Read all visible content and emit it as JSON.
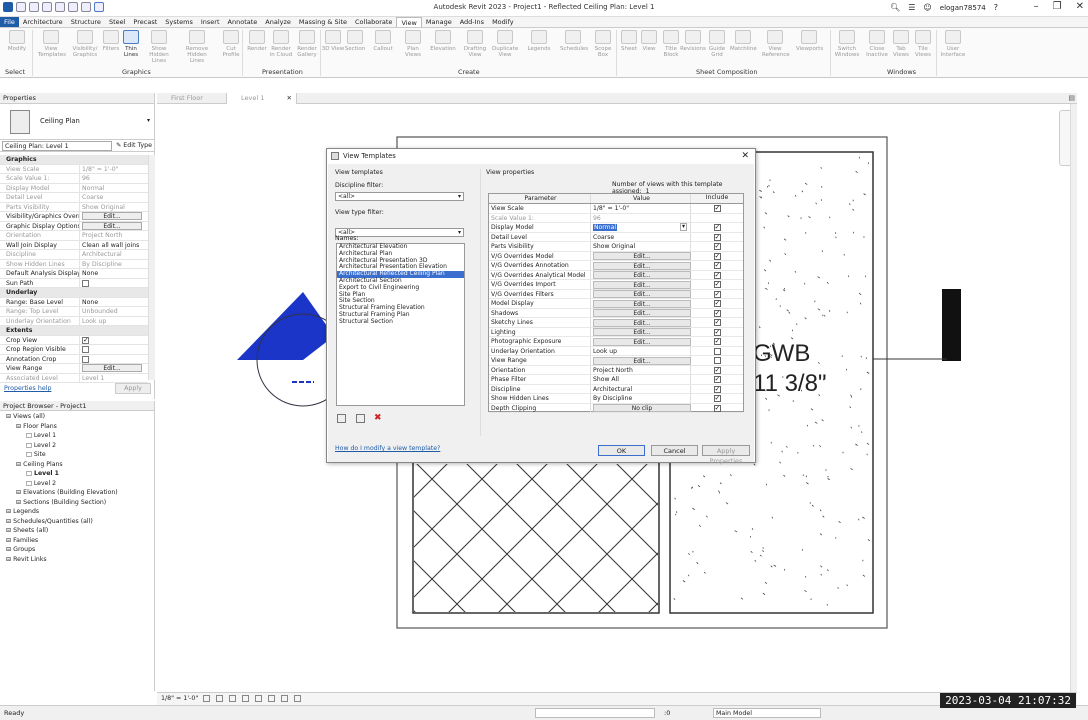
{
  "titlebar": {
    "title": "Autodesk Revit 2023 - Project1 - Reflected Ceiling Plan: Level 1",
    "user": "elogan78574"
  },
  "tabs": [
    "File",
    "Architecture",
    "Structure",
    "Steel",
    "Precast",
    "Systems",
    "Insert",
    "Annotate",
    "Analyze",
    "Massing & Site",
    "Collaborate",
    "View",
    "Manage",
    "Add-Ins",
    "Modify"
  ],
  "ribbon": {
    "buttons": [
      "Modify",
      "View Templates",
      "Visibility/ Graphics",
      "Filters",
      "Thin Lines",
      "Show Hidden Lines",
      "Remove Hidden Lines",
      "Cut Profile",
      "Render",
      "Render in Cloud",
      "Render Gallery",
      "3D View",
      "Section",
      "Callout",
      "Plan Views",
      "Elevation",
      "Drafting View",
      "Duplicate View",
      "Legends",
      "Schedules",
      "Scope Box",
      "Sheet",
      "View",
      "Title Block",
      "Revisions",
      "Guide Grid",
      "Matchline",
      "View Reference",
      "Viewports",
      "Switch Windows",
      "Close Inactive",
      "Tab Views",
      "Tile Views",
      "User Interface"
    ],
    "groups": [
      "Select",
      "Graphics",
      "Presentation",
      "Create",
      "Sheet Composition",
      "Windows"
    ]
  },
  "properties": {
    "title": "Properties",
    "type_name": "Ceiling Plan",
    "instance": "Ceiling Plan: Level 1",
    "edit_type": "Edit Type",
    "rows": [
      {
        "k": "Graphics",
        "sec": true
      },
      {
        "k": "View Scale",
        "v": "1/8\" = 1'-0\"",
        "dim": true
      },
      {
        "k": "Scale Value    1:",
        "v": "96",
        "dim": true
      },
      {
        "k": "Display Model",
        "v": "Normal",
        "dim": true
      },
      {
        "k": "Detail Level",
        "v": "Coarse",
        "dim": true
      },
      {
        "k": "Parts Visibility",
        "v": "Show Original",
        "dim": true
      },
      {
        "k": "Visibility/Graphics Overr...",
        "v": "Edit...",
        "btn": true
      },
      {
        "k": "Graphic Display Options",
        "v": "Edit...",
        "btn": true
      },
      {
        "k": "Orientation",
        "v": "Project North",
        "dim": true
      },
      {
        "k": "Wall Join Display",
        "v": "Clean all wall joins"
      },
      {
        "k": "Discipline",
        "v": "Architectural",
        "dim": true
      },
      {
        "k": "Show Hidden Lines",
        "v": "By Discipline",
        "dim": true
      },
      {
        "k": "Default Analysis Display...",
        "v": "None"
      },
      {
        "k": "Sun Path",
        "cb": true
      },
      {
        "k": "Underlay",
        "sec": true
      },
      {
        "k": "Range: Base Level",
        "v": "None"
      },
      {
        "k": "Range: Top Level",
        "v": "Unbounded",
        "dim": true
      },
      {
        "k": "Underlay Orientation",
        "v": "Look up",
        "dim": true
      },
      {
        "k": "Extents",
        "sec": true
      },
      {
        "k": "Crop View",
        "cb": true,
        "on": true
      },
      {
        "k": "Crop Region Visible",
        "cb": true
      },
      {
        "k": "Annotation Crop",
        "cb": true
      },
      {
        "k": "View Range",
        "v": "Edit...",
        "btn": true
      },
      {
        "k": "Associated Level",
        "v": "Level 1",
        "dim": true
      }
    ],
    "help": "Properties help",
    "apply": "Apply"
  },
  "browser": {
    "title": "Project Browser - Project1",
    "items": [
      {
        "t": "Views (all)",
        "d": 0
      },
      {
        "t": "Floor Plans",
        "d": 1
      },
      {
        "t": "Level 1",
        "d": 2
      },
      {
        "t": "Level 2",
        "d": 2
      },
      {
        "t": "Site",
        "d": 2
      },
      {
        "t": "Ceiling Plans",
        "d": 1
      },
      {
        "t": "Level 1",
        "d": 2,
        "b": true
      },
      {
        "t": "Level 2",
        "d": 2
      },
      {
        "t": "Elevations (Building Elevation)",
        "d": 1
      },
      {
        "t": "Sections (Building Section)",
        "d": 1
      },
      {
        "t": "Legends",
        "d": 0
      },
      {
        "t": "Schedules/Quantities (all)",
        "d": 0
      },
      {
        "t": "Sheets (all)",
        "d": 0
      },
      {
        "t": "Families",
        "d": 0
      },
      {
        "t": "Groups",
        "d": 0
      },
      {
        "t": "Revit Links",
        "d": 0
      }
    ]
  },
  "viewtabs": [
    "First Floor",
    "Level 1"
  ],
  "canvas": {
    "tag1": "GWB",
    "tag2": "11 3/8\""
  },
  "dialog": {
    "title": "View Templates",
    "left_header": "View templates",
    "discipline_label": "Discipline filter:",
    "discipline_value": "<all>",
    "type_label": "View type filter:",
    "type_value": "<all>",
    "names_label": "Names:",
    "names": [
      "Architectural Elevation",
      "Architectural Plan",
      "Architectural Presentation 3D",
      "Architectural Presentation Elevation",
      "Architectural Reflected Ceiling Plan",
      "Architectural Section",
      "Export to Civil Engineering",
      "Site Plan",
      "Site Section",
      "Structural Framing Elevation",
      "Structural Framing Plan",
      "Structural Section"
    ],
    "selected_index": 4,
    "right_header": "View properties",
    "assigned_label": "Number of views with this template assigned:",
    "assigned_count": "1",
    "col_param": "Parameter",
    "col_value": "Value",
    "col_include": "Include",
    "rows": [
      {
        "p": "View Scale",
        "v": "1/8\" = 1'-0\"",
        "i": true
      },
      {
        "p": "Scale Value    1:",
        "v": "96",
        "dim": true
      },
      {
        "p": "Display Model",
        "v": "Normal",
        "i": true,
        "dd": true
      },
      {
        "p": "Detail Level",
        "v": "Coarse",
        "i": true
      },
      {
        "p": "Parts Visibility",
        "v": "Show Original",
        "i": true
      },
      {
        "p": "V/G Overrides Model",
        "v": "Edit...",
        "btn": true,
        "i": true
      },
      {
        "p": "V/G Overrides Annotation",
        "v": "Edit...",
        "btn": true,
        "i": true
      },
      {
        "p": "V/G Overrides Analytical Model",
        "v": "Edit...",
        "btn": true,
        "i": true
      },
      {
        "p": "V/G Overrides Import",
        "v": "Edit...",
        "btn": true,
        "i": true
      },
      {
        "p": "V/G Overrides Filters",
        "v": "Edit...",
        "btn": true,
        "i": true
      },
      {
        "p": "Model Display",
        "v": "Edit...",
        "btn": true,
        "i": true
      },
      {
        "p": "Shadows",
        "v": "Edit...",
        "btn": true,
        "i": true
      },
      {
        "p": "Sketchy Lines",
        "v": "Edit...",
        "btn": true,
        "i": true
      },
      {
        "p": "Lighting",
        "v": "Edit...",
        "btn": true,
        "i": true
      },
      {
        "p": "Photographic Exposure",
        "v": "Edit...",
        "btn": true,
        "i": true
      },
      {
        "p": "Underlay Orientation",
        "v": "Look up",
        "i": false
      },
      {
        "p": "View Range",
        "v": "Edit...",
        "btn": true,
        "i": false
      },
      {
        "p": "Orientation",
        "v": "Project North",
        "i": true
      },
      {
        "p": "Phase Filter",
        "v": "Show All",
        "i": true
      },
      {
        "p": "Discipline",
        "v": "Architectural",
        "i": true
      },
      {
        "p": "Show Hidden Lines",
        "v": "By Discipline",
        "i": true
      },
      {
        "p": "Depth Clipping",
        "v": "No clip",
        "btn": true,
        "i": true
      }
    ],
    "help": "How do I modify a view template?",
    "ok": "OK",
    "cancel": "Cancel",
    "apply": "Apply Properties"
  },
  "viewbar": {
    "scale": "1/8\" = 1'-0\""
  },
  "status": {
    "text": "Ready",
    "zero": ":0",
    "model": "Main Model"
  },
  "clock": "2023-03-04  21:07:32"
}
